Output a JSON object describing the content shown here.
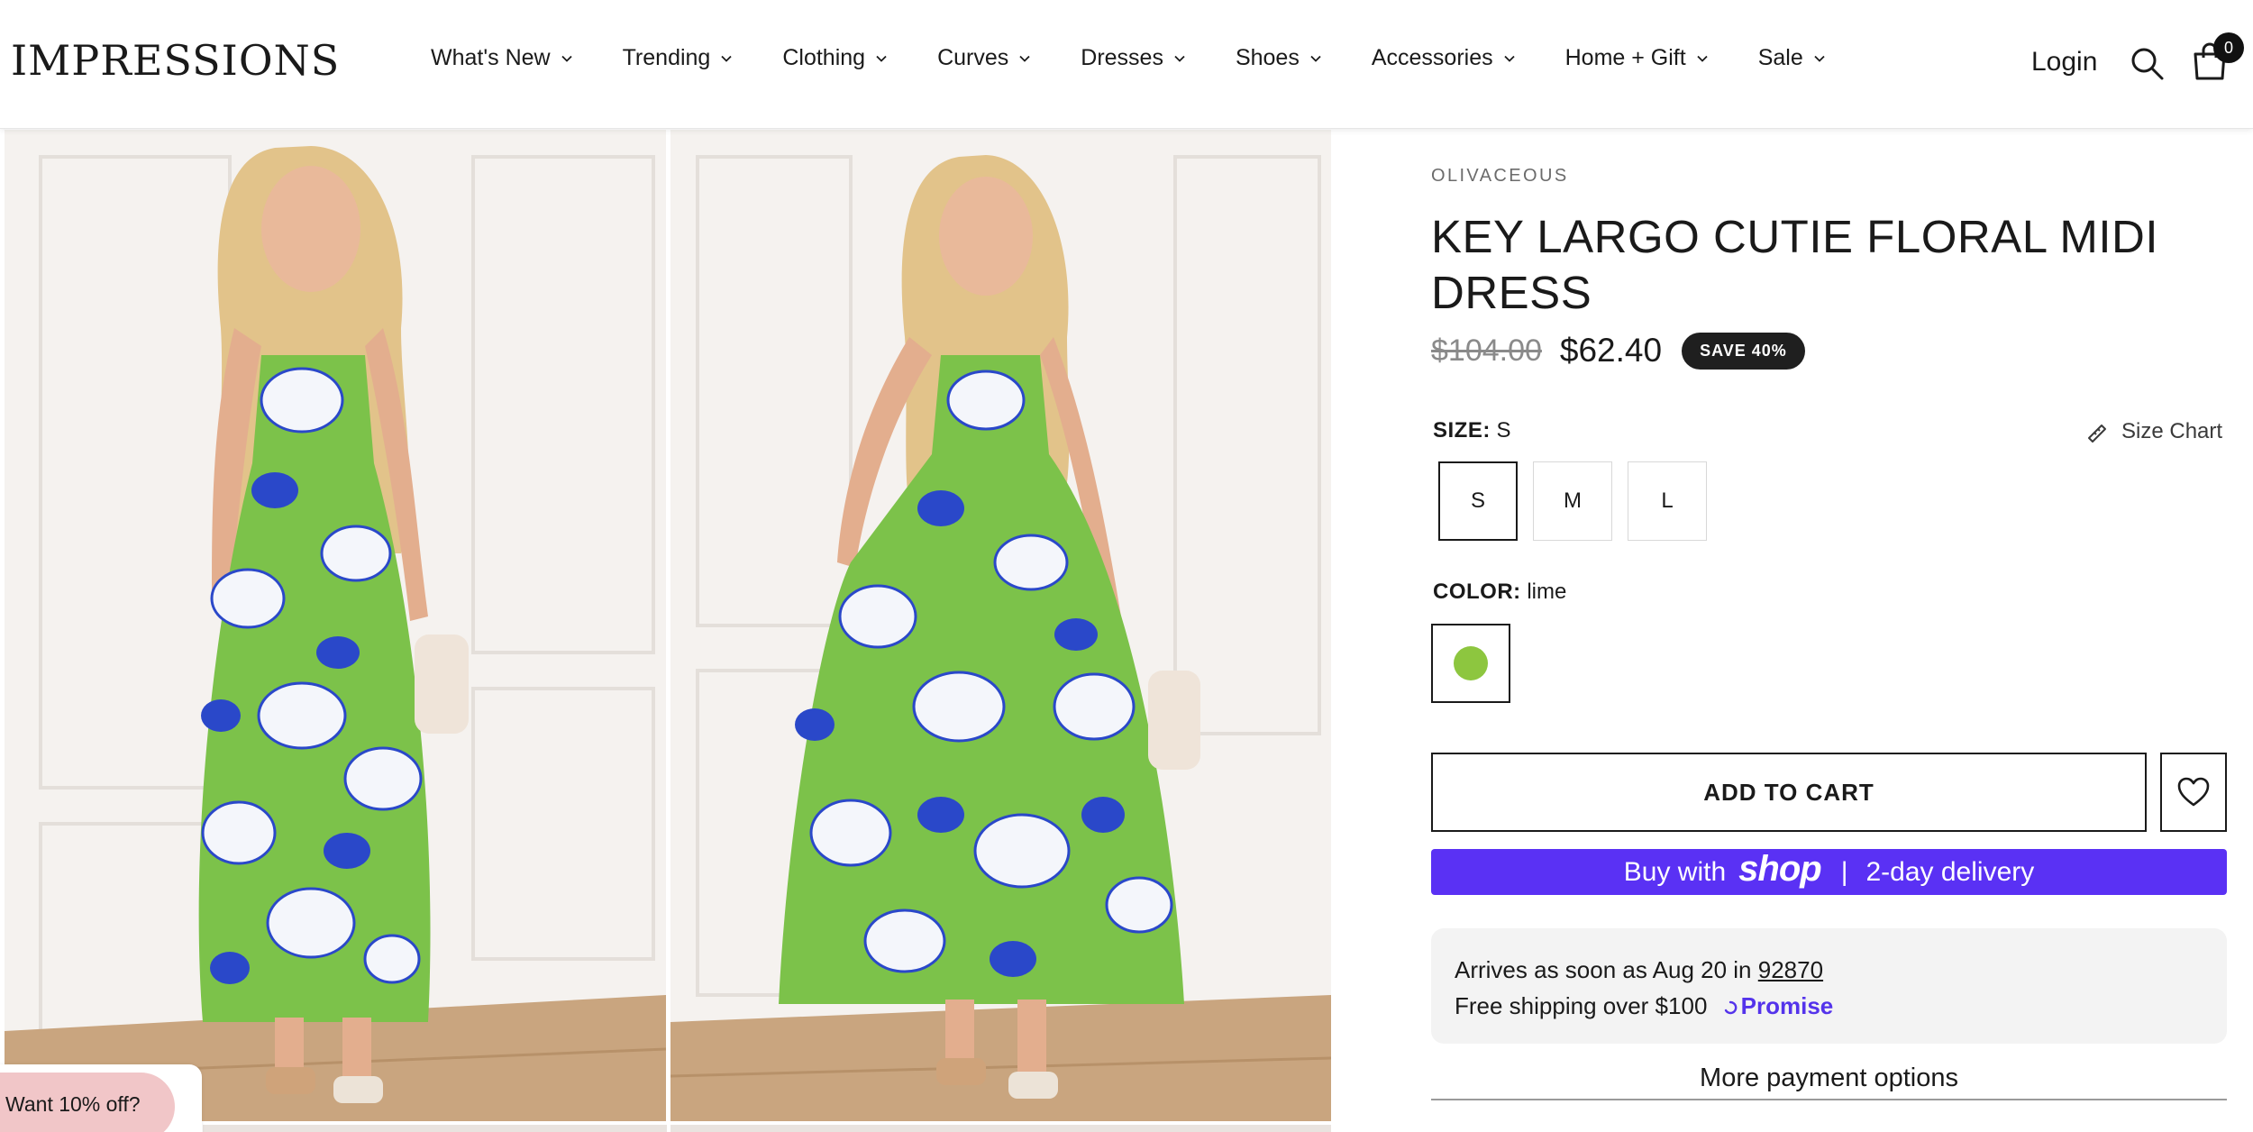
{
  "header": {
    "logo": "IMPRESSIONS",
    "nav": [
      {
        "label": "What's New"
      },
      {
        "label": "Trending"
      },
      {
        "label": "Clothing"
      },
      {
        "label": "Curves"
      },
      {
        "label": "Dresses"
      },
      {
        "label": "Shoes"
      },
      {
        "label": "Accessories"
      },
      {
        "label": "Home + Gift"
      },
      {
        "label": "Sale"
      }
    ],
    "login": "Login",
    "search_icon": "search-icon",
    "cart_icon": "cart-icon",
    "cart_count": "0"
  },
  "product": {
    "vendor": "OLIVACEOUS",
    "title": "KEY LARGO CUTIE FLORAL MIDI DRESS",
    "price_original": "$104.00",
    "price_sale": "$62.40",
    "save_badge": "SAVE 40%",
    "size_label": "SIZE:",
    "size_selected": "S",
    "size_chart": "Size Chart",
    "sizes": [
      {
        "label": "S",
        "selected": true
      },
      {
        "label": "M",
        "selected": false
      },
      {
        "label": "L",
        "selected": false
      }
    ],
    "color_label": "COLOR:",
    "color_selected": "lime",
    "swatch_color": "#8dc63f",
    "add_to_cart": "ADD TO CART",
    "wishlist_icon": "heart-icon"
  },
  "shop_pay": {
    "prefix": "Buy with",
    "brand": "shop",
    "separator": "|",
    "suffix": "2-day delivery",
    "color": "#5a31f4"
  },
  "delivery": {
    "line1_prefix": "Arrives as soon as Aug 20 in",
    "zip": "92870",
    "line2": "Free shipping over $100",
    "promise": "Promise"
  },
  "more_payment": "More payment options",
  "promo": {
    "label": "Want 10% off?"
  },
  "colors": {
    "dress_green": "#7cc24a",
    "wall": "#f4f1ee",
    "floor": "#c9a57f",
    "badge_bg": "#1f1f1f",
    "promo_pink": "#f1c6c8"
  }
}
